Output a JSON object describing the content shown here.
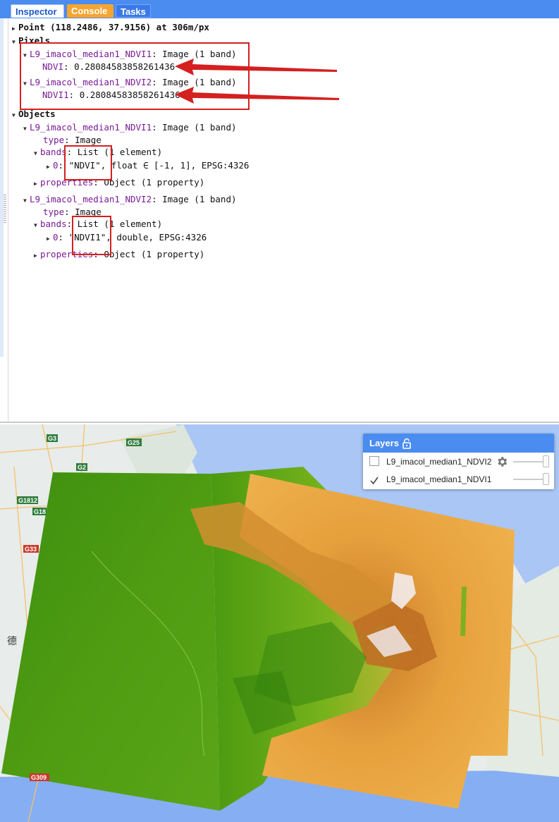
{
  "tabs": {
    "inspector": "Inspector",
    "console": "Console",
    "tasks": "Tasks"
  },
  "inspector": {
    "point": "Point (118.2486, 37.9156) at 306m/px",
    "pixels_header": "Pixels",
    "pixels": [
      {
        "name": "L9_imacol_median1_NDVI1",
        "type": ": Image (1 band)",
        "band_label": "NDVI",
        "band_value": ": 0.28084583858261436"
      },
      {
        "name": "L9_imacol_median1_NDVI2",
        "type": ": Image (1 band)",
        "band_label": "NDVI1",
        "band_value": ": 0.28084583858261436"
      }
    ],
    "objects_header": "Objects",
    "objects": [
      {
        "name": "L9_imacol_median1_NDVI1",
        "type": ": Image (1 band)",
        "type_key": "type",
        "type_val": ": Image",
        "bands_key": "bands",
        "bands_val": ": List (1 element)",
        "band_entry_key": "0",
        "band_entry_val": ": \"NDVI\", float ∈ [-1, 1], EPSG:4326",
        "props_key": "properties",
        "props_val": ": Object (1 property)"
      },
      {
        "name": "L9_imacol_median1_NDVI2",
        "type": ": Image (1 band)",
        "type_key": "type",
        "type_val": ": Image",
        "bands_key": "bands",
        "bands_val": ": List (1 element)",
        "band_entry_key": "0",
        "band_entry_val": ": \"NDVI1\", double, EPSG:4326",
        "props_key": "properties",
        "props_val": ": Object (1 property)"
      }
    ]
  },
  "layers": {
    "title": "Layers",
    "items": [
      {
        "name": "L9_imacol_median1_NDVI2",
        "checked": false
      },
      {
        "name": "L9_imacol_median1_NDVI1",
        "checked": true
      }
    ]
  },
  "map_labels": {
    "g3": "G3",
    "g25": "G25",
    "g2": "G2",
    "g1812": "G1812",
    "g18": "G18",
    "g33": "G33",
    "g309": "G309",
    "city": "德"
  },
  "colors": {
    "accent": "#4a8cf0",
    "console": "#f7a531",
    "annotation": "#d42020",
    "key": "#7a1a96"
  }
}
